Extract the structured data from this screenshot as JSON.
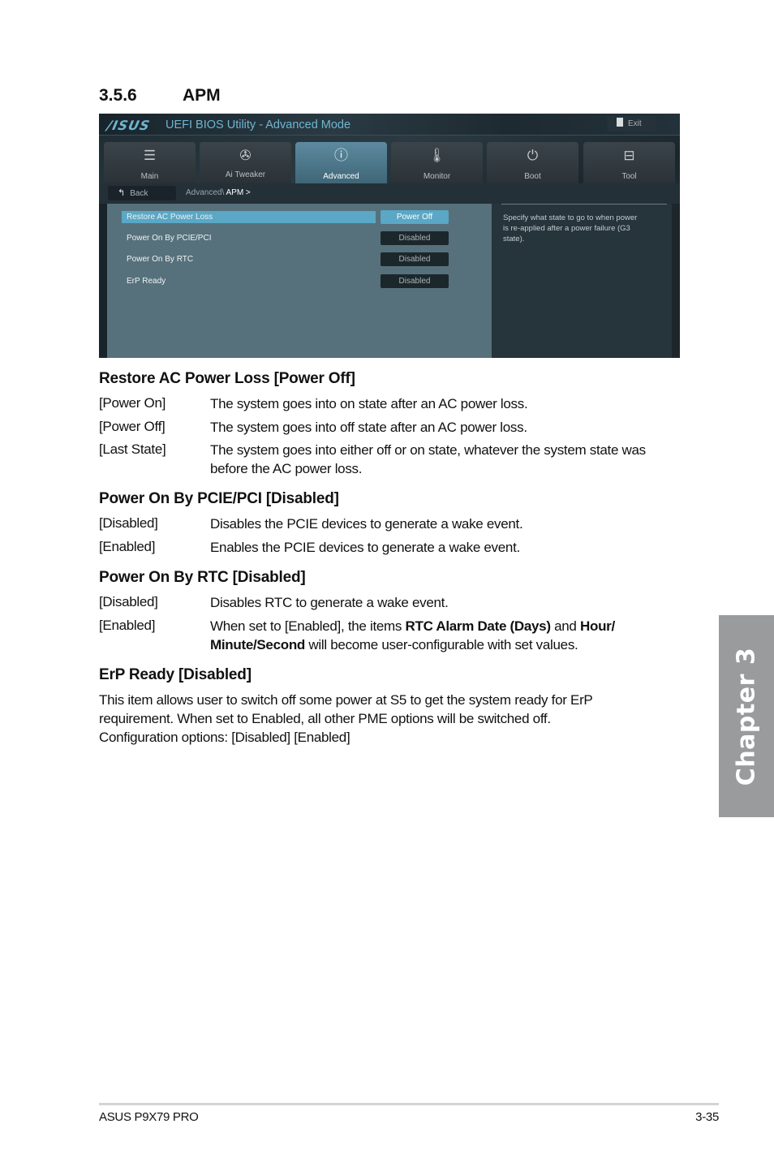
{
  "section": {
    "number": "3.5.6",
    "title": "APM"
  },
  "bios": {
    "logo": "/ISUS",
    "title": "UEFI BIOS Utility - Advanced Mode",
    "exit_label": "Exit",
    "tabs": [
      {
        "label": "Main",
        "icon": "list-icon",
        "glyph": "☰"
      },
      {
        "label": "Ai  Tweaker",
        "icon": "fan-icon",
        "glyph": "✇"
      },
      {
        "label": "Advanced",
        "icon": "advanced-info-icon",
        "glyph": "ⓘ",
        "active": true
      },
      {
        "label": "Monitor",
        "icon": "thermometer-icon",
        "glyph": "🌡"
      },
      {
        "label": "Boot",
        "icon": "power-icon",
        "glyph": "⏻"
      },
      {
        "label": "Tool",
        "icon": "toolbox-icon",
        "glyph": "⊟"
      }
    ],
    "back_label": "Back",
    "breadcrumb": {
      "path": "Advanced\\ ",
      "current": "APM",
      "suffix": " >"
    },
    "items": [
      {
        "label": "Restore AC Power Loss",
        "value": "Power Off",
        "selected": true
      },
      {
        "label": "Power On By PCIE/PCI",
        "value": "Disabled"
      },
      {
        "label": "Power On By RTC",
        "value": "Disabled"
      },
      {
        "label": "ErP Ready",
        "value": "Disabled"
      }
    ],
    "help_text": "Specify what state to go to when power is re-applied after a power failure (G3 state).",
    "colors": {
      "accent": "#5aa7c6",
      "panel": "#56717c",
      "title": "#6fb6d0"
    }
  },
  "doc": {
    "restore": {
      "heading": "Restore AC Power Loss [Power Off]",
      "options": [
        {
          "opt": "[Power On]",
          "desc": "The system goes into on state after an AC power loss."
        },
        {
          "opt": "[Power Off]",
          "desc": "The system goes into off state after an AC power loss."
        },
        {
          "opt": "[Last State]",
          "desc": "The system goes into either off or on state, whatever the system state was before the AC power loss."
        }
      ]
    },
    "pcie": {
      "heading": "Power On By PCIE/PCI [Disabled]",
      "options": [
        {
          "opt": "[Disabled]",
          "desc": "Disables the PCIE devices to generate a wake event."
        },
        {
          "opt": "[Enabled]",
          "desc": "Enables the PCIE devices to generate a wake event."
        }
      ]
    },
    "rtc": {
      "heading": "Power On By RTC [Disabled]",
      "options": [
        {
          "opt": "[Disabled]",
          "desc": "Disables RTC to generate a wake event."
        },
        {
          "opt": "[Enabled]",
          "desc_parts": [
            "When set to [Enabled], the items ",
            "RTC Alarm Date (Days)",
            " and ",
            "Hour/ Minute/Second",
            " will become user-configurable with set values."
          ]
        }
      ]
    },
    "erp": {
      "heading": "ErP Ready [Disabled]",
      "lines": [
        "This item allows user to switch off some power at S5 to get the system ready for ErP",
        "requirement. When set to Enabled, all other PME options will be switched off.",
        "Configuration options: [Disabled] [Enabled]"
      ]
    }
  },
  "chapter_tab": "Chapter 3",
  "footer": {
    "product": "ASUS P9X79 PRO",
    "page": "3-35"
  }
}
